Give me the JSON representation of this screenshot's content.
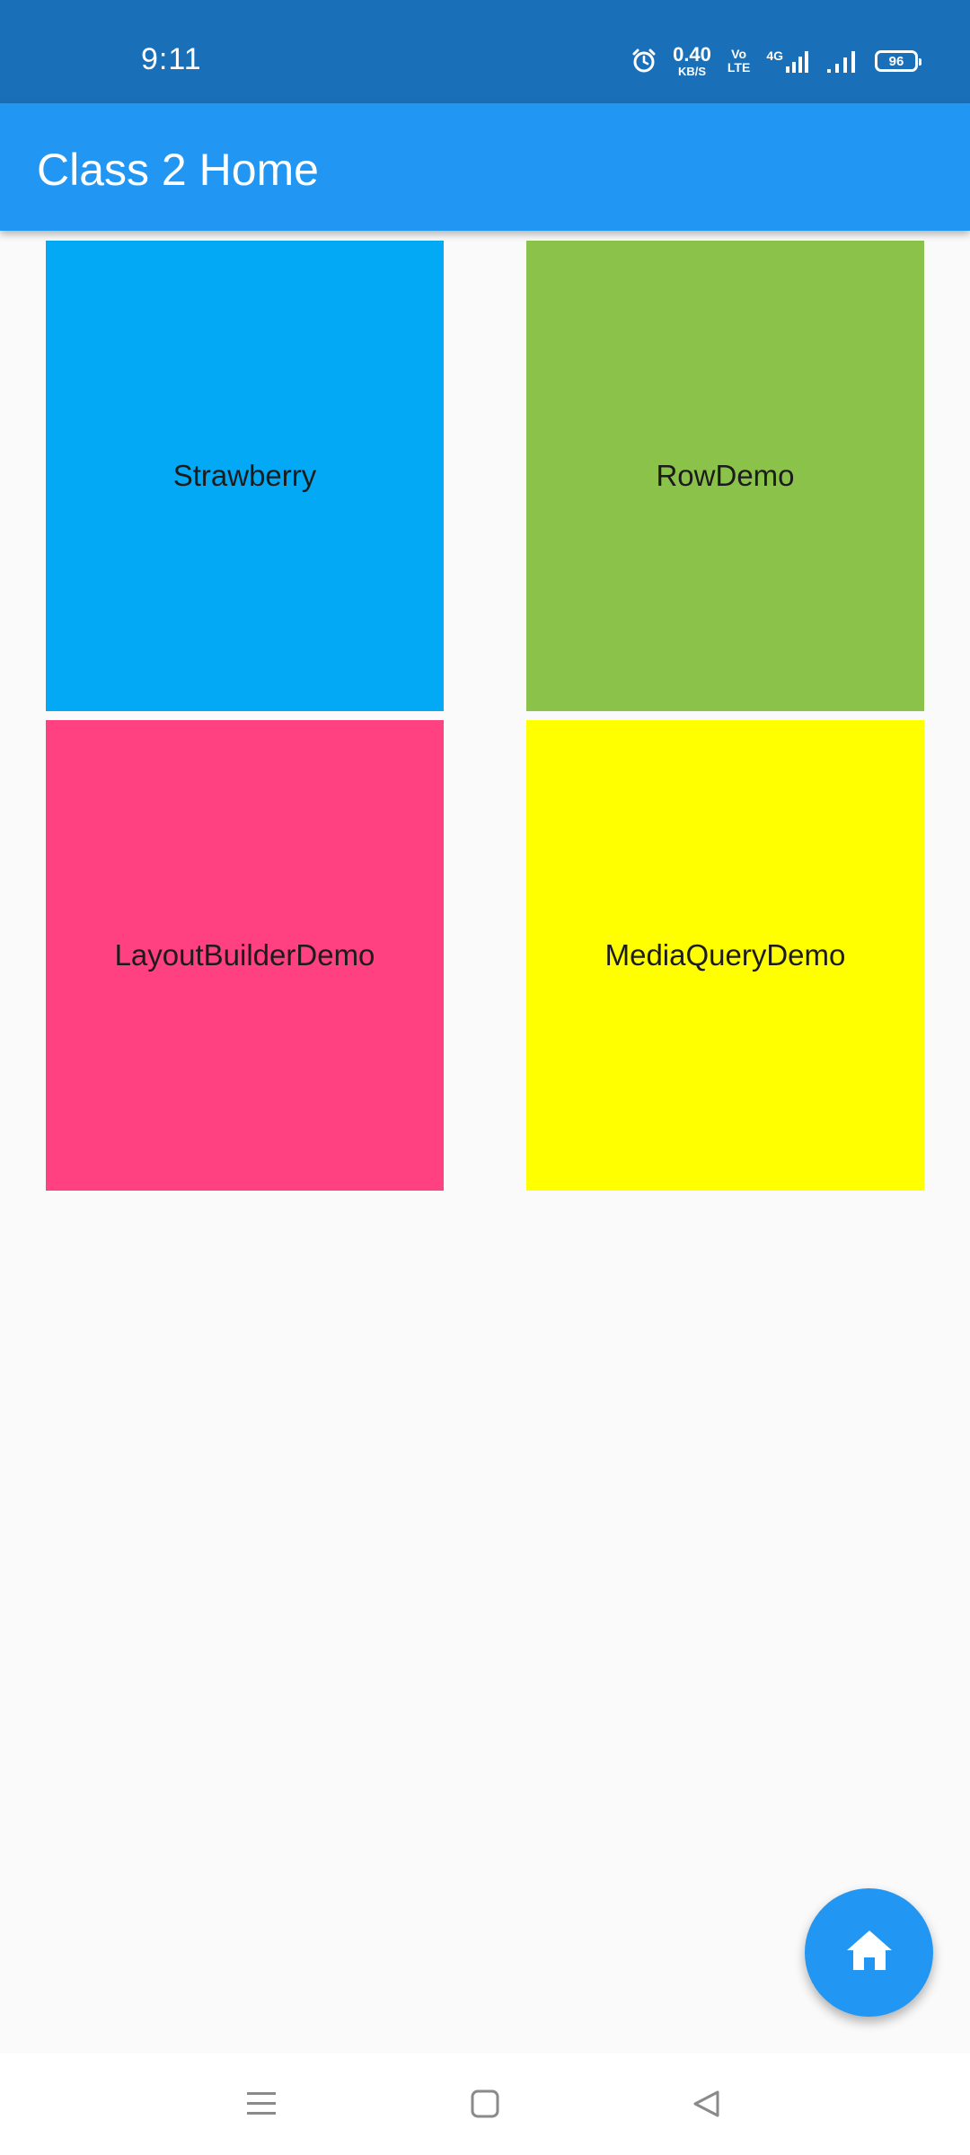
{
  "status_bar": {
    "time": "9:11",
    "net_speed_value": "0.40",
    "net_speed_unit": "KB/S",
    "volte_top": "Vo",
    "volte_bottom": "LTE",
    "network_type": "4G",
    "battery_level": "96",
    "icons": [
      "alarm-icon",
      "signal-icon",
      "signal-icon",
      "battery-icon"
    ]
  },
  "app_bar": {
    "title": "Class 2 Home"
  },
  "tiles": [
    {
      "label": "Strawberry",
      "color": "#03a9f4"
    },
    {
      "label": "RowDemo",
      "color": "#8bc34a"
    },
    {
      "label": "LayoutBuilderDemo",
      "color": "#ff4081"
    },
    {
      "label": "MediaQueryDemo",
      "color": "#ffff00"
    }
  ],
  "fab": {
    "icon": "home-icon",
    "color": "#2196f3"
  },
  "nav_bar": {
    "icons": [
      "menu-icon",
      "square-icon",
      "back-triangle-icon"
    ]
  }
}
